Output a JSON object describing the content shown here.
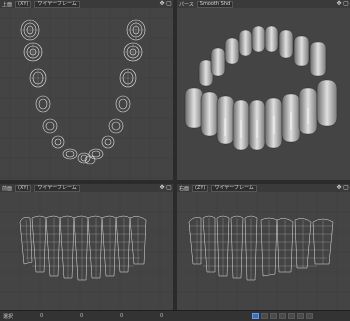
{
  "viewports": {
    "top": {
      "view": "上面",
      "mode": "(XY)",
      "display": "ワイヤーフレーム"
    },
    "persp": {
      "view": "パース",
      "display": "Smooth Shd"
    },
    "front": {
      "view": "前面",
      "mode": "(XY)",
      "display": "ワイヤーフレーム"
    },
    "right": {
      "view": "右面",
      "mode": "(ZY)",
      "display": "ワイヤーフレーム"
    }
  },
  "statusbar": {
    "select_label": "選択",
    "numbers": [
      "0",
      "0",
      "0",
      "0"
    ]
  },
  "colors": {
    "viewport_bg": "#444444",
    "grid": "#3a3a3a",
    "grid_major": "#333333",
    "wire": "#e6e6e6",
    "accent": "#3f6fb0"
  }
}
